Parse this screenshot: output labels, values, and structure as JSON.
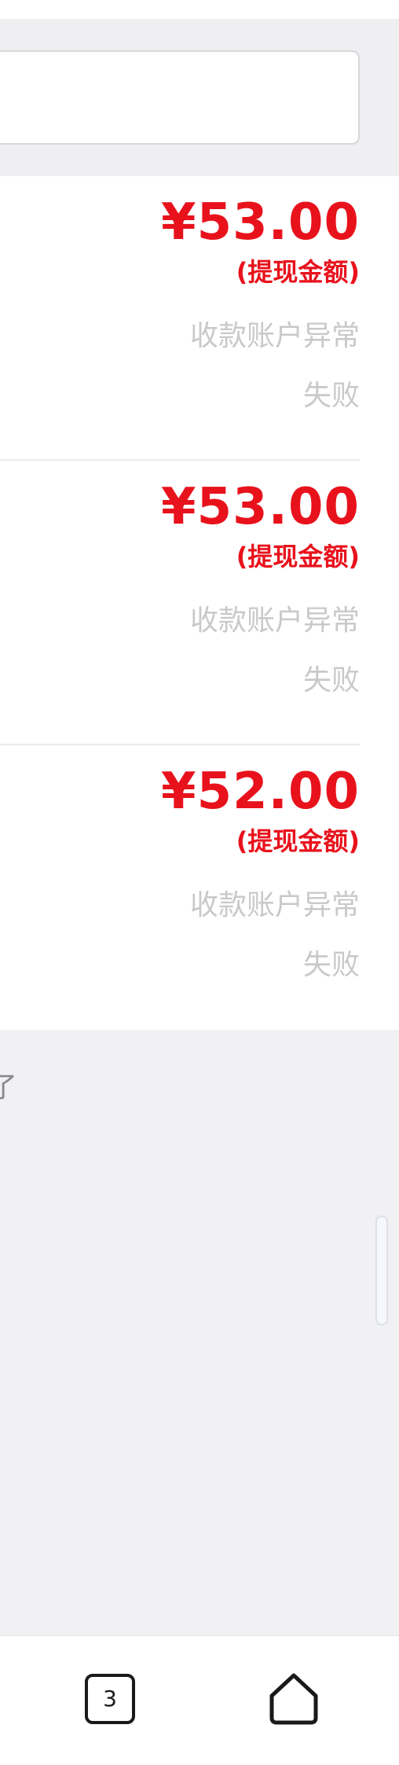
{
  "colors": {
    "accent": "#e8121c",
    "muted_text": "#c9c9cb",
    "page_background": "#f1f1f3",
    "card_background": "#ffffff"
  },
  "records": [
    {
      "amount": "¥53.00",
      "amount_label": "(提现金额)",
      "reason": "收款账户异常",
      "status": "失败"
    },
    {
      "amount": "¥53.00",
      "amount_label": "(提现金额)",
      "reason": "收款账户异常",
      "status": "失败"
    },
    {
      "amount": "¥52.00",
      "amount_label": "(提现金额)",
      "reason": "收款账户异常",
      "status": "失败"
    }
  ],
  "list_end_text": "了",
  "bottom_nav": {
    "tab_count": "3",
    "tabs_icon": "tabs-square-icon",
    "home_icon": "home-icon"
  }
}
